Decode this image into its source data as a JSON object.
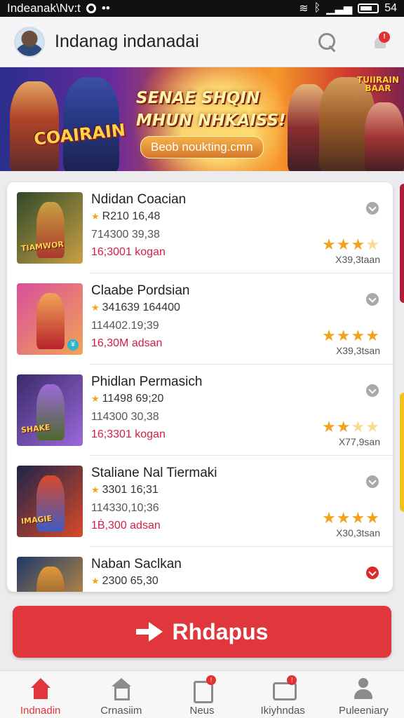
{
  "status_bar": {
    "left_text": "Indeanak\\Nv:t",
    "right_text": "54"
  },
  "header": {
    "title": "Indanag indanadai"
  },
  "banner": {
    "logo_left": "COAIRAIN",
    "headline_line1": "SENAE SHQIN",
    "headline_line2": "MHUN NHKAISS!",
    "pill_text": "Beob noukting.cmn",
    "logo_right": "TUIIRAIN BAAR"
  },
  "list": {
    "items": [
      {
        "title": "Ndidan Coacian",
        "line1": "R210 16,48",
        "line2": "714300 39,38",
        "price": "16;3001 kogan",
        "stars_on": 3,
        "count": "X39,3taan",
        "thumb_label": "TIAMWOR",
        "colors": [
          "#2f4a2a",
          "#c9a043",
          "#a8382c"
        ]
      },
      {
        "title": "Claabe Pordsian",
        "line1": "341639  164400",
        "line2": "114402.19;39",
        "price": "16,30M adsan",
        "stars_on": 4,
        "count": "X39,3tsan",
        "thumb_label": "",
        "colors": [
          "#d94f9c",
          "#f1a356",
          "#b8242c"
        ]
      },
      {
        "title": "Phidlan Permasich",
        "line1": "11498 69;20",
        "line2": "114300 30,38",
        "price": "16;3301 kogan",
        "stars_on": 2,
        "count": "X77,9san",
        "thumb_label": "SHAKE",
        "colors": [
          "#3a2a6a",
          "#9a6ad9",
          "#4e6a2e"
        ]
      },
      {
        "title": "Staliane Nal Tiermaki",
        "line1": "3301 16;31",
        "line2": "114330,10;36",
        "price": "1Ḃ,300 adsan",
        "stars_on": 4,
        "count": "X30,3tsan",
        "thumb_label": "IMAGIE",
        "colors": [
          "#1e2448",
          "#d84a2a",
          "#3f5bc2"
        ]
      },
      {
        "title": "Naban Saclkan",
        "line1": "2300 65,30",
        "line2": "",
        "price": "",
        "stars_on": 0,
        "count": "",
        "thumb_label": "",
        "colors": [
          "#1e3a6a",
          "#e09a3a",
          "#5a3a2a"
        ]
      }
    ]
  },
  "cta": {
    "label": "Rhdapus"
  },
  "bottom_nav": {
    "items": [
      {
        "label": "Indnadin",
        "icon": "home-icon",
        "badge": ""
      },
      {
        "label": "Crnasiim",
        "icon": "store-icon",
        "badge": ""
      },
      {
        "label": "Neus",
        "icon": "news-icon",
        "badge": "!"
      },
      {
        "label": "Ikiyhndas",
        "icon": "message-icon",
        "badge": "!"
      },
      {
        "label": "Puleeniary",
        "icon": "user-icon",
        "badge": ""
      }
    ]
  },
  "colors": {
    "accent": "#e0373c",
    "price": "#d11e48",
    "star": "#f2a21c"
  }
}
